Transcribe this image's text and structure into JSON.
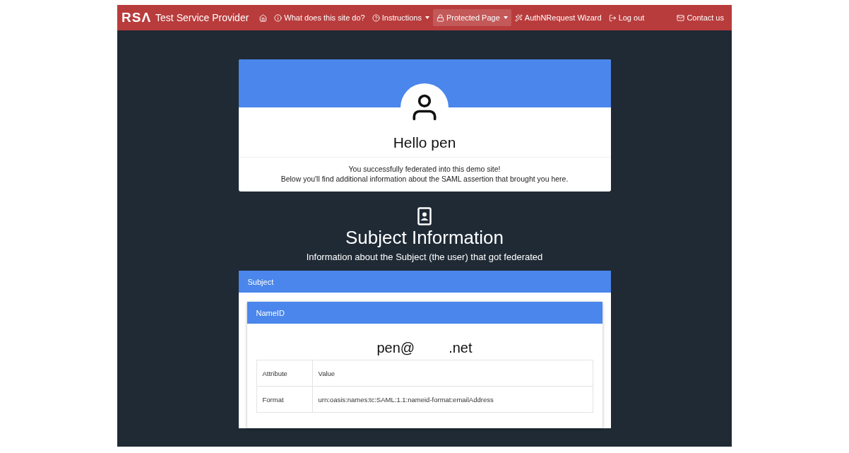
{
  "navbar": {
    "logo": "RSΛ",
    "title": "Test Service Provider",
    "items": [
      {
        "kind": "home",
        "selected": false,
        "dropdown": false
      },
      {
        "kind": "info",
        "label": "What does this site do?",
        "selected": false,
        "dropdown": false
      },
      {
        "kind": "help",
        "label": "Instructions",
        "selected": false,
        "dropdown": true
      },
      {
        "kind": "lock",
        "label": "Protected Page",
        "selected": true,
        "dropdown": true
      },
      {
        "kind": "wand",
        "label": "AuthNRequest Wizard",
        "selected": false,
        "dropdown": false
      },
      {
        "kind": "logout",
        "label": "Log out",
        "selected": false,
        "dropdown": false
      }
    ],
    "contact": "Contact us"
  },
  "welcome": {
    "greeting": "Hello pen",
    "lines": [
      "You successfully federated into this demo site!",
      "Below you'll find additional information about the SAML assertion that brought you here."
    ]
  },
  "section": {
    "title": "Subject Information",
    "subtitle": "Information about the Subject (the user) that got federated"
  },
  "subject_card": {
    "header": "Subject",
    "nameid_card": {
      "header": "NameID",
      "value_start": "pen@",
      "value_end": ".net",
      "table": {
        "columns": [
          "Attribute",
          "Value"
        ],
        "rows": [
          [
            "Format",
            "urn:oasis:names:tc:SAML:1.1:nameid-format:emailAddress"
          ]
        ]
      }
    }
  }
}
